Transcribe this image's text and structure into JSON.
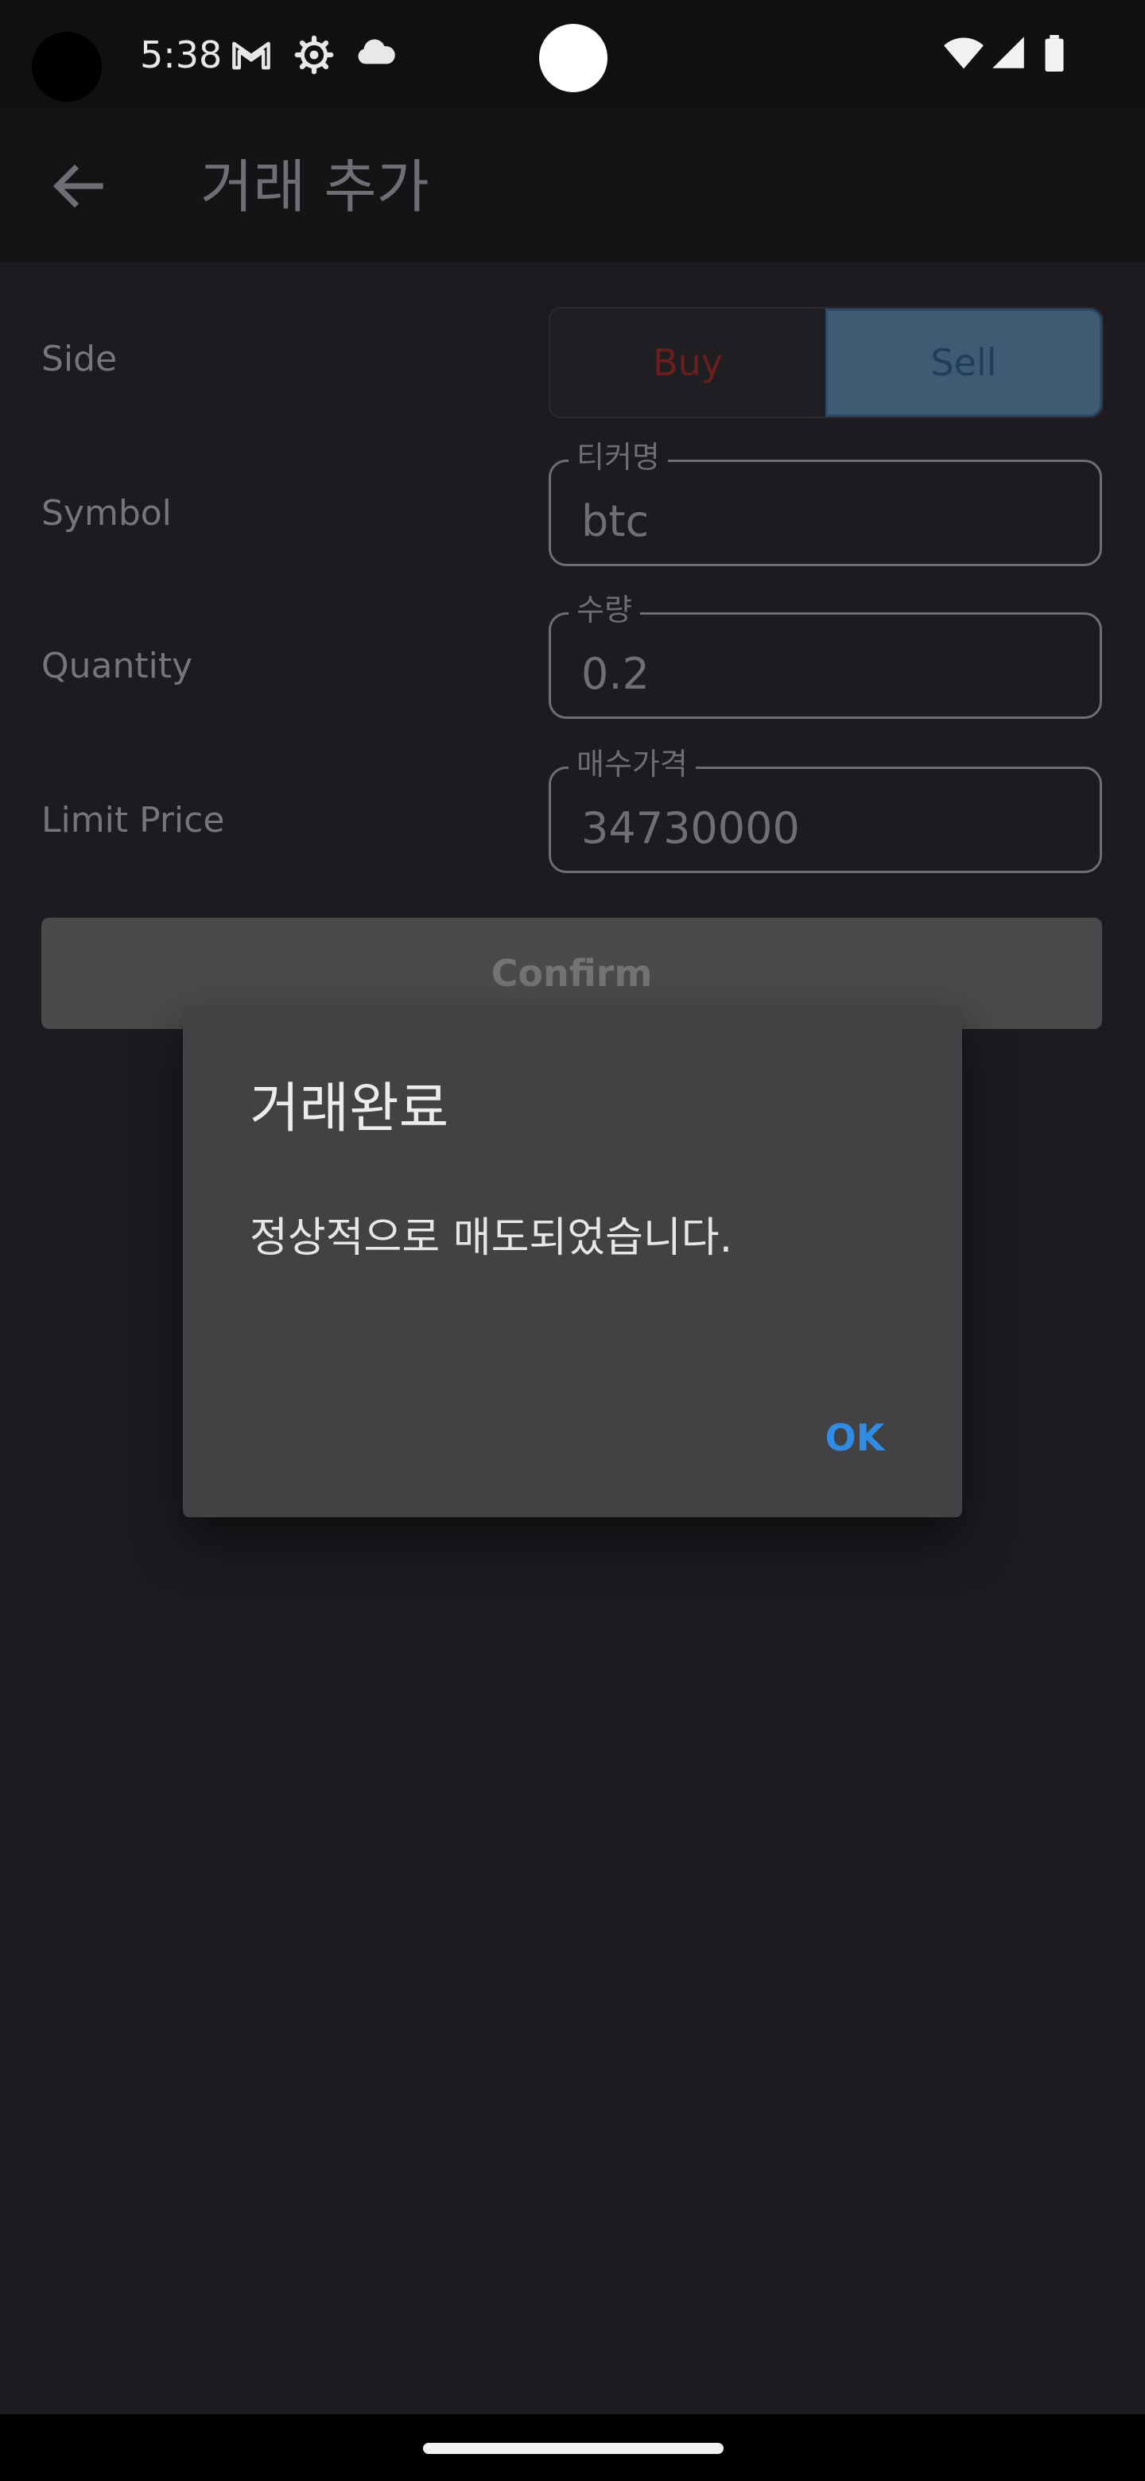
{
  "status_bar": {
    "time": "5:38",
    "icons": [
      "gmail-icon",
      "settings-gear-icon",
      "cloud-icon",
      "wifi-icon",
      "cell-signal-icon",
      "battery-icon"
    ]
  },
  "app_bar": {
    "back_icon": "arrow-back-icon",
    "title": "거래 추가"
  },
  "form": {
    "side_label": "Side",
    "side_options": {
      "buy": "Buy",
      "sell": "Sell"
    },
    "side_selected": "Sell",
    "symbol_label": "Symbol",
    "symbol_legend": "티커명",
    "symbol_value": "btc",
    "quantity_label": "Quantity",
    "quantity_legend": "수량",
    "quantity_value": "0.2",
    "limit_price_label": "Limit Price",
    "limit_price_legend": "매수가격",
    "limit_price_value": "34730000",
    "confirm_label": "Confirm"
  },
  "dialog": {
    "title": "거래완료",
    "message": "정상적으로 매도되었습니다.",
    "ok_label": "OK"
  },
  "colors": {
    "background": "#1c1b20",
    "dialog_background": "#424244",
    "ok_accent": "#2f8be3",
    "sell_selected": "#3f5a73",
    "buy_text": "#6b1f1d"
  }
}
